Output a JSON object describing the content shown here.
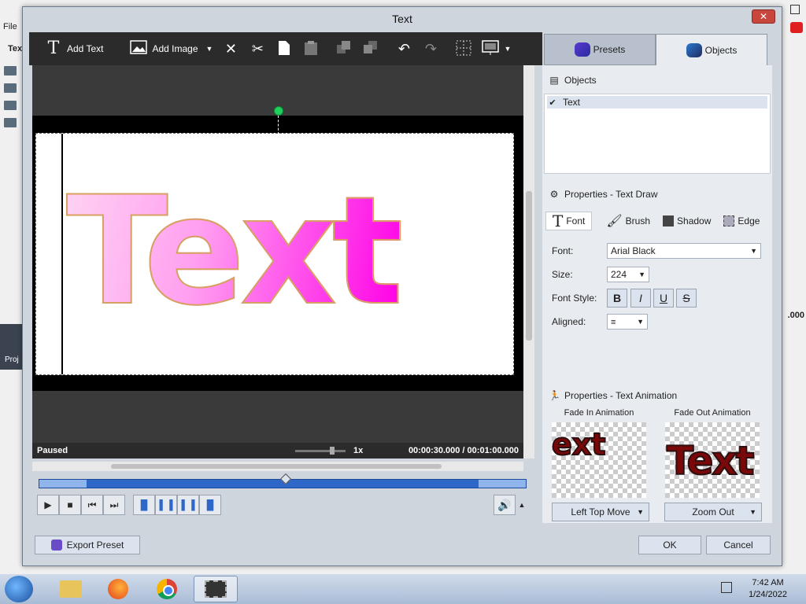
{
  "background": {
    "menu_file": "File",
    "tex_label": "Tex",
    "proj_label": "Proj",
    "time_fragment": ".000"
  },
  "dialog": {
    "title": "Text",
    "close": "✕"
  },
  "toolbar": {
    "add_text": "Add Text",
    "add_image": "Add Image"
  },
  "tabs": {
    "presets": "Presets",
    "objects": "Objects"
  },
  "preview": {
    "text": "Text",
    "status": "Paused",
    "speed": "1x",
    "time": "00:00:30.000  /  00:01:00.000"
  },
  "objects_panel": {
    "header": "Objects",
    "items": [
      {
        "label": "Text",
        "checked": true
      }
    ]
  },
  "properties": {
    "header": "Properties - Text Draw",
    "subtabs": [
      "Font",
      "Brush",
      "Shadow",
      "Edge"
    ],
    "font_label": "Font:",
    "font_value": "Arial Black",
    "size_label": "Size:",
    "size_value": "224",
    "style_label": "Font Style:",
    "style_buttons": [
      "B",
      "I",
      "U",
      "S"
    ],
    "aligned_label": "Aligned:"
  },
  "animation": {
    "header": "Properties - Text Animation",
    "fade_in_label": "Fade In Animation",
    "fade_out_label": "Fade Out Animation",
    "fade_in_preview": "ext",
    "fade_out_preview": "Text",
    "fade_in_value": "Left Top Move",
    "fade_out_value": "Zoom Out"
  },
  "buttons": {
    "export_preset": "Export Preset",
    "ok": "OK",
    "cancel": "Cancel"
  },
  "taskbar": {
    "time": "7:42 AM",
    "date": "1/24/2022"
  },
  "colors": {
    "text_gradient_start": "#ffd2f3",
    "text_gradient_end": "#ff00e6",
    "text_outline": "#d8a060",
    "timeline": "#2f67c8"
  }
}
